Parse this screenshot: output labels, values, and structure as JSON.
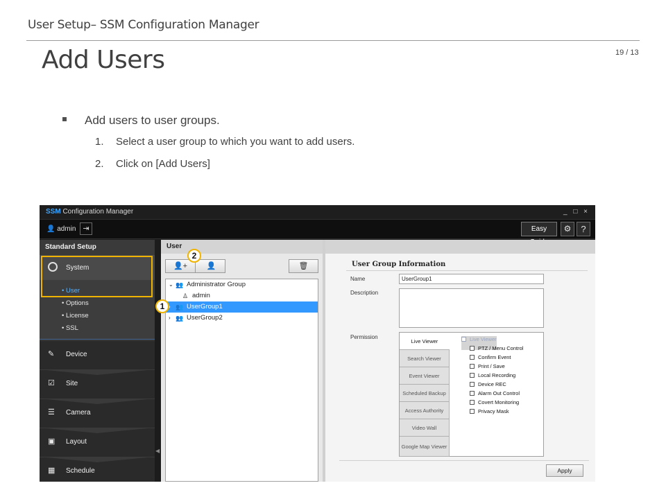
{
  "slide": {
    "header": "User Setup– SSM Configuration Manager",
    "title": "Add Users",
    "page_number": "19 / 13",
    "bullet": "Add users to user groups.",
    "steps": [
      {
        "n": "1.",
        "text": "Select a user group to which you want to add users."
      },
      {
        "n": "2.",
        "text": "Click on [Add Users]"
      }
    ]
  },
  "app": {
    "title_brand": "SSM",
    "title_rest": " Configuration Manager",
    "window_controls": "_ □ ×",
    "user": "admin",
    "easy_guide": "Easy Guide",
    "help": "?",
    "sidebar": {
      "section": "Standard Setup",
      "system": "System",
      "sub_items": [
        "• User",
        "• Options",
        "• License",
        "• SSL"
      ],
      "nav_items": [
        "Device",
        "Site",
        "Camera",
        "Layout",
        "Schedule"
      ]
    },
    "user_panel": {
      "title": "User",
      "tree": {
        "admin_group": "Administrator Group",
        "admin_user": "admin",
        "group1": "UserGroup1",
        "group2": "UserGroup2"
      }
    },
    "info_panel": {
      "title": "User Group Information",
      "name_label": "Name",
      "name_value": "UserGroup1",
      "description_label": "Description",
      "permission_label": "Permission",
      "tabs": [
        "Live Viewer",
        "Search Viewer",
        "Event Viewer",
        "Scheduled Backup",
        "Access Authority",
        "Video Wall",
        "Google Map Viewer"
      ],
      "options_head": "Live Viewer",
      "options": [
        "PTZ / Menu Control",
        "Confirm Event",
        "Print / Save",
        "Local Recording",
        "Device REC",
        "Alarm Out Control",
        "Covert Monitoring",
        "Privacy Mask"
      ],
      "apply": "Apply"
    },
    "callouts": [
      "1",
      "2"
    ]
  }
}
